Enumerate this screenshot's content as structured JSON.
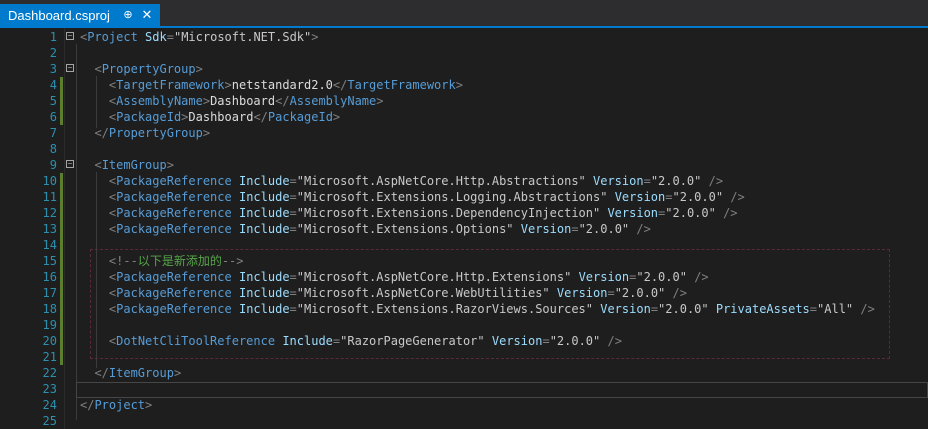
{
  "tab": {
    "title": "Dashboard.csproj",
    "pin_glyph": "⊕",
    "close_glyph": "✕"
  },
  "lines": [
    {
      "n": "1",
      "fold": "minus",
      "code": [
        [
          "b",
          "<"
        ],
        [
          "tag",
          "Project"
        ],
        [
          "t",
          " "
        ],
        [
          "attr",
          "Sdk"
        ],
        [
          "b",
          "="
        ],
        [
          "str",
          "\"Microsoft.NET.Sdk\""
        ],
        [
          "b",
          ">"
        ]
      ]
    },
    {
      "n": "2",
      "code": []
    },
    {
      "n": "3",
      "fold": "minus",
      "code": [
        [
          "t",
          "  "
        ],
        [
          "b",
          "<"
        ],
        [
          "tag",
          "PropertyGroup"
        ],
        [
          "b",
          ">"
        ]
      ]
    },
    {
      "n": "4",
      "chg": true,
      "code": [
        [
          "t",
          "    "
        ],
        [
          "b",
          "<"
        ],
        [
          "tag",
          "TargetFramework"
        ],
        [
          "b",
          ">"
        ],
        [
          "t",
          "netstandard2.0"
        ],
        [
          "b",
          "</"
        ],
        [
          "tag",
          "TargetFramework"
        ],
        [
          "b",
          ">"
        ]
      ]
    },
    {
      "n": "5",
      "chg": true,
      "code": [
        [
          "t",
          "    "
        ],
        [
          "b",
          "<"
        ],
        [
          "tag",
          "AssemblyName"
        ],
        [
          "b",
          ">"
        ],
        [
          "t",
          "Dashboard"
        ],
        [
          "b",
          "</"
        ],
        [
          "tag",
          "AssemblyName"
        ],
        [
          "b",
          ">"
        ]
      ]
    },
    {
      "n": "6",
      "chg": true,
      "code": [
        [
          "t",
          "    "
        ],
        [
          "b",
          "<"
        ],
        [
          "tag",
          "PackageId"
        ],
        [
          "b",
          ">"
        ],
        [
          "t",
          "Dashboard"
        ],
        [
          "b",
          "</"
        ],
        [
          "tag",
          "PackageId"
        ],
        [
          "b",
          ">"
        ]
      ]
    },
    {
      "n": "7",
      "code": [
        [
          "t",
          "  "
        ],
        [
          "b",
          "</"
        ],
        [
          "tag",
          "PropertyGroup"
        ],
        [
          "b",
          ">"
        ]
      ]
    },
    {
      "n": "8",
      "code": []
    },
    {
      "n": "9",
      "fold": "minus",
      "code": [
        [
          "t",
          "  "
        ],
        [
          "b",
          "<"
        ],
        [
          "tag",
          "ItemGroup"
        ],
        [
          "b",
          ">"
        ]
      ]
    },
    {
      "n": "10",
      "chg": true,
      "code": [
        [
          "t",
          "    "
        ],
        [
          "b",
          "<"
        ],
        [
          "tag",
          "PackageReference"
        ],
        [
          "t",
          " "
        ],
        [
          "attr",
          "Include"
        ],
        [
          "b",
          "="
        ],
        [
          "str",
          "\"Microsoft.AspNetCore.Http.Abstractions\""
        ],
        [
          "t",
          " "
        ],
        [
          "attr",
          "Version"
        ],
        [
          "b",
          "="
        ],
        [
          "str",
          "\"2.0.0\""
        ],
        [
          "t",
          " "
        ],
        [
          "b",
          "/>"
        ]
      ]
    },
    {
      "n": "11",
      "chg": true,
      "code": [
        [
          "t",
          "    "
        ],
        [
          "b",
          "<"
        ],
        [
          "tag",
          "PackageReference"
        ],
        [
          "t",
          " "
        ],
        [
          "attr",
          "Include"
        ],
        [
          "b",
          "="
        ],
        [
          "str",
          "\"Microsoft.Extensions.Logging.Abstractions\""
        ],
        [
          "t",
          " "
        ],
        [
          "attr",
          "Version"
        ],
        [
          "b",
          "="
        ],
        [
          "str",
          "\"2.0.0\""
        ],
        [
          "t",
          " "
        ],
        [
          "b",
          "/>"
        ]
      ]
    },
    {
      "n": "12",
      "chg": true,
      "code": [
        [
          "t",
          "    "
        ],
        [
          "b",
          "<"
        ],
        [
          "tag",
          "PackageReference"
        ],
        [
          "t",
          " "
        ],
        [
          "attr",
          "Include"
        ],
        [
          "b",
          "="
        ],
        [
          "str",
          "\"Microsoft.Extensions.DependencyInjection\""
        ],
        [
          "t",
          " "
        ],
        [
          "attr",
          "Version"
        ],
        [
          "b",
          "="
        ],
        [
          "str",
          "\"2.0.0\""
        ],
        [
          "t",
          " "
        ],
        [
          "b",
          "/>"
        ]
      ]
    },
    {
      "n": "13",
      "chg": true,
      "code": [
        [
          "t",
          "    "
        ],
        [
          "b",
          "<"
        ],
        [
          "tag",
          "PackageReference"
        ],
        [
          "t",
          " "
        ],
        [
          "attr",
          "Include"
        ],
        [
          "b",
          "="
        ],
        [
          "str",
          "\"Microsoft.Extensions.Options\""
        ],
        [
          "t",
          " "
        ],
        [
          "attr",
          "Version"
        ],
        [
          "b",
          "="
        ],
        [
          "str",
          "\"2.0.0\""
        ],
        [
          "t",
          " "
        ],
        [
          "b",
          "/>"
        ]
      ]
    },
    {
      "n": "14",
      "chg": true,
      "code": []
    },
    {
      "n": "15",
      "chg": true,
      "code": [
        [
          "t",
          "    "
        ],
        [
          "b",
          "<!--"
        ],
        [
          "com",
          "以下是新添加的"
        ],
        [
          "b",
          "-->"
        ]
      ]
    },
    {
      "n": "16",
      "chg": true,
      "code": [
        [
          "t",
          "    "
        ],
        [
          "b",
          "<"
        ],
        [
          "tag",
          "PackageReference"
        ],
        [
          "t",
          " "
        ],
        [
          "attr",
          "Include"
        ],
        [
          "b",
          "="
        ],
        [
          "str",
          "\"Microsoft.AspNetCore.Http.Extensions\""
        ],
        [
          "t",
          " "
        ],
        [
          "attr",
          "Version"
        ],
        [
          "b",
          "="
        ],
        [
          "str",
          "\"2.0.0\""
        ],
        [
          "t",
          " "
        ],
        [
          "b",
          "/>"
        ]
      ]
    },
    {
      "n": "17",
      "chg": true,
      "code": [
        [
          "t",
          "    "
        ],
        [
          "b",
          "<"
        ],
        [
          "tag",
          "PackageReference"
        ],
        [
          "t",
          " "
        ],
        [
          "attr",
          "Include"
        ],
        [
          "b",
          "="
        ],
        [
          "str",
          "\"Microsoft.AspNetCore.WebUtilities\""
        ],
        [
          "t",
          " "
        ],
        [
          "attr",
          "Version"
        ],
        [
          "b",
          "="
        ],
        [
          "str",
          "\"2.0.0\""
        ],
        [
          "t",
          " "
        ],
        [
          "b",
          "/>"
        ]
      ]
    },
    {
      "n": "18",
      "chg": true,
      "code": [
        [
          "t",
          "    "
        ],
        [
          "b",
          "<"
        ],
        [
          "tag",
          "PackageReference"
        ],
        [
          "t",
          " "
        ],
        [
          "attr",
          "Include"
        ],
        [
          "b",
          "="
        ],
        [
          "str",
          "\"Microsoft.Extensions.RazorViews.Sources\""
        ],
        [
          "t",
          " "
        ],
        [
          "attr",
          "Version"
        ],
        [
          "b",
          "="
        ],
        [
          "str",
          "\"2.0.0\""
        ],
        [
          "t",
          " "
        ],
        [
          "attr",
          "PrivateAssets"
        ],
        [
          "b",
          "="
        ],
        [
          "str",
          "\"All\""
        ],
        [
          "t",
          " "
        ],
        [
          "b",
          "/>"
        ]
      ]
    },
    {
      "n": "19",
      "chg": true,
      "code": []
    },
    {
      "n": "20",
      "chg": true,
      "code": [
        [
          "t",
          "    "
        ],
        [
          "b",
          "<"
        ],
        [
          "tag",
          "DotNetCliToolReference"
        ],
        [
          "t",
          " "
        ],
        [
          "attr",
          "Include"
        ],
        [
          "b",
          "="
        ],
        [
          "str",
          "\"RazorPageGenerator\""
        ],
        [
          "t",
          " "
        ],
        [
          "attr",
          "Version"
        ],
        [
          "b",
          "="
        ],
        [
          "str",
          "\"2.0.0\""
        ],
        [
          "t",
          " "
        ],
        [
          "b",
          "/>"
        ]
      ]
    },
    {
      "n": "21",
      "chg": true,
      "code": []
    },
    {
      "n": "22",
      "code": [
        [
          "t",
          "  "
        ],
        [
          "b",
          "</"
        ],
        [
          "tag",
          "ItemGroup"
        ],
        [
          "b",
          ">"
        ]
      ]
    },
    {
      "n": "23",
      "code": []
    },
    {
      "n": "24",
      "code": [
        [
          "b",
          "</"
        ],
        [
          "tag",
          "Project"
        ],
        [
          "b",
          ">"
        ]
      ]
    },
    {
      "n": "25",
      "code": []
    }
  ]
}
